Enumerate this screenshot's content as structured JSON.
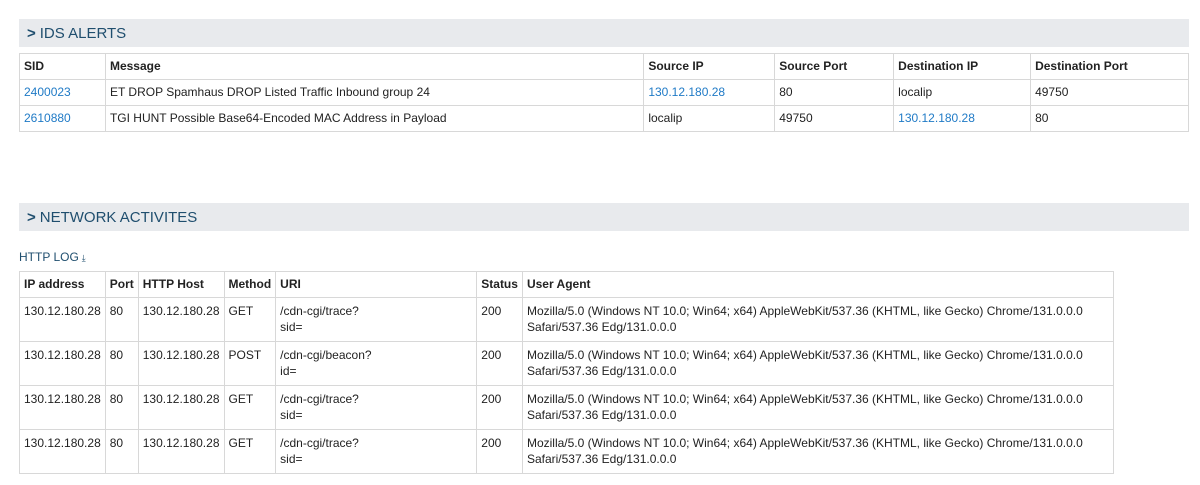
{
  "ids": {
    "header": "IDS ALERTS",
    "columns": [
      "SID",
      "Message",
      "Source IP",
      "Source Port",
      "Destination IP",
      "Destination Port"
    ],
    "rows": [
      {
        "sid": "2400023",
        "message": "ET DROP Spamhaus DROP Listed Traffic Inbound group 24",
        "src_ip": "130.12.180.28",
        "src_port": "80",
        "dst_ip": "localip",
        "dst_port": "49750"
      },
      {
        "sid": "2610880",
        "message": "TGI HUNT Possible Base64-Encoded MAC Address in Payload",
        "src_ip": "localip",
        "src_port": "49750",
        "dst_ip": "130.12.180.28",
        "dst_port": "80"
      }
    ]
  },
  "network": {
    "header": "NETWORK ACTIVITES",
    "http_log_label": "HTTP LOG",
    "columns": [
      "IP address",
      "Port",
      "HTTP Host",
      "Method",
      "URI",
      "Status",
      "User Agent"
    ],
    "rows": [
      {
        "ip": "130.12.180.28",
        "port": "80",
        "host": "130.12.180.28",
        "method": "GET",
        "uri_1": "/cdn-cgi/trace?",
        "uri_2": "sid=",
        "status": "200",
        "ua_1": "Mozilla/5.0 (Windows NT 10.0; Win64; x64) AppleWebKit/537.36 (KHTML, like Gecko) Chrome/131.0.0.0",
        "ua_2": "Safari/537.36 Edg/131.0.0.0"
      },
      {
        "ip": "130.12.180.28",
        "port": "80",
        "host": "130.12.180.28",
        "method": "POST",
        "uri_1": "/cdn-cgi/beacon?",
        "uri_2": "id=",
        "status": "200",
        "ua_1": "Mozilla/5.0 (Windows NT 10.0; Win64; x64) AppleWebKit/537.36 (KHTML, like Gecko) Chrome/131.0.0.0",
        "ua_2": "Safari/537.36 Edg/131.0.0.0"
      },
      {
        "ip": "130.12.180.28",
        "port": "80",
        "host": "130.12.180.28",
        "method": "GET",
        "uri_1": "/cdn-cgi/trace?",
        "uri_2": "sid=",
        "status": "200",
        "ua_1": "Mozilla/5.0 (Windows NT 10.0; Win64; x64) AppleWebKit/537.36 (KHTML, like Gecko) Chrome/131.0.0.0",
        "ua_2": "Safari/537.36 Edg/131.0.0.0"
      },
      {
        "ip": "130.12.180.28",
        "port": "80",
        "host": "130.12.180.28",
        "method": "GET",
        "uri_1": "/cdn-cgi/trace?",
        "uri_2": "sid=",
        "status": "200",
        "ua_1": "Mozilla/5.0 (Windows NT 10.0; Win64; x64) AppleWebKit/537.36 (KHTML, like Gecko) Chrome/131.0.0.0",
        "ua_2": "Safari/537.36 Edg/131.0.0.0"
      }
    ]
  },
  "colors": {
    "header_bg": "#e8eaed",
    "header_text": "#1f4e6e",
    "link": "#1f7ac6"
  }
}
